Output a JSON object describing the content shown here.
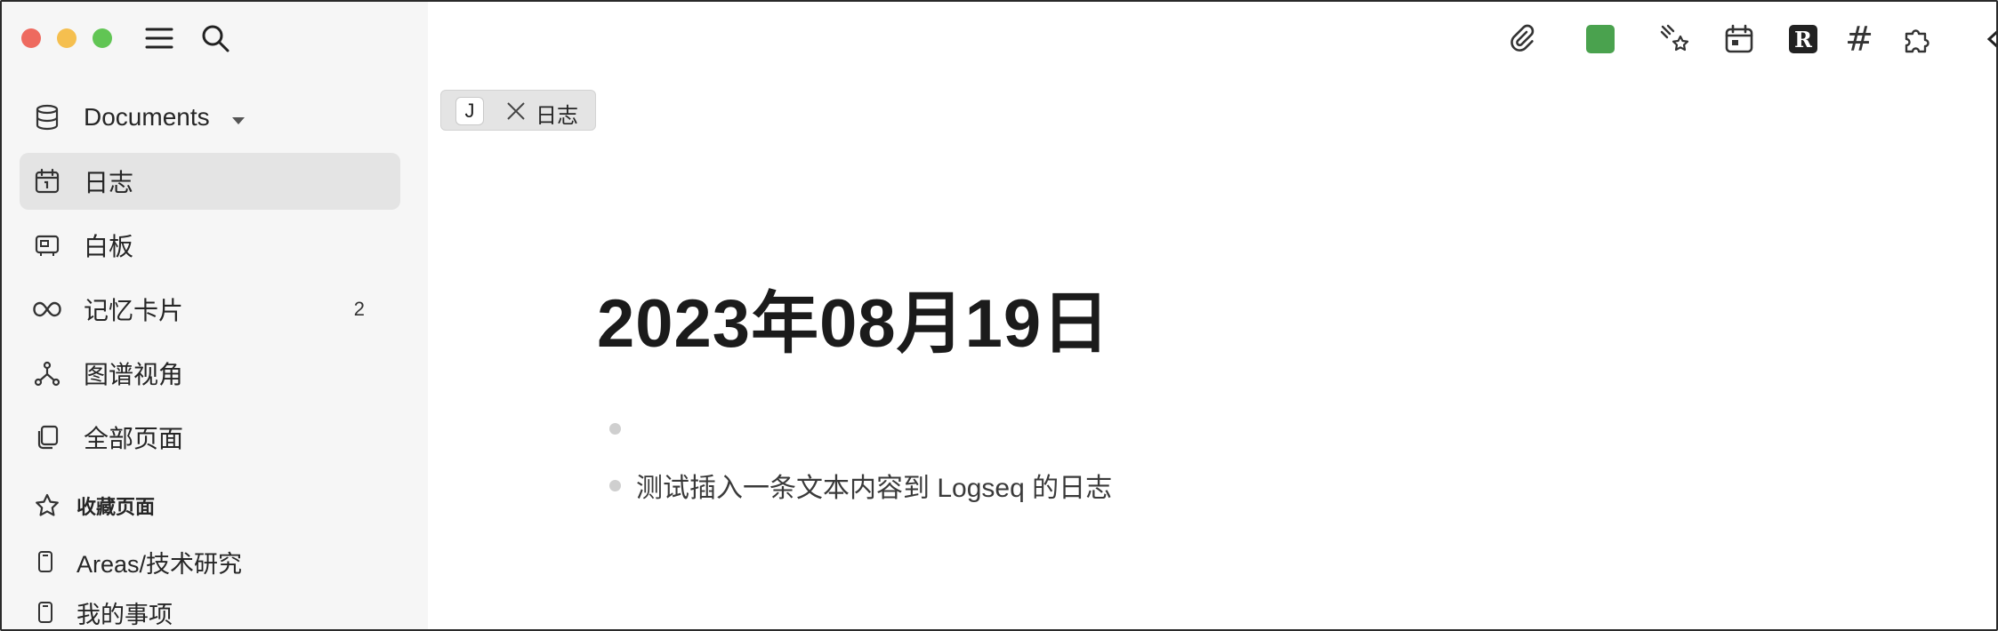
{
  "sidebar": {
    "graph_selector": {
      "label": "Documents",
      "icon": "database-icon"
    },
    "nav": [
      {
        "label": "日志",
        "icon": "calendar-icon",
        "active": true
      },
      {
        "label": "白板",
        "icon": "whiteboard-icon"
      },
      {
        "label": "记忆卡片",
        "icon": "infinity-icon",
        "count": "2"
      },
      {
        "label": "图谱视角",
        "icon": "graph-icon"
      },
      {
        "label": "全部页面",
        "icon": "pages-icon"
      }
    ],
    "favorites_header": "收藏页面",
    "favorites": [
      {
        "label": "Areas/技术研究"
      },
      {
        "label": "我的事项"
      }
    ]
  },
  "tab": {
    "badge": "J",
    "label": "日志"
  },
  "page": {
    "title": "2023年08月19日",
    "blocks": [
      {
        "text": ""
      },
      {
        "text": "测试插入一条文本内容到 Logseq 的日志"
      }
    ]
  },
  "toolbar": {
    "icons": [
      "paperclip-icon",
      "green-square",
      "sparkles-icon",
      "calendar-icon",
      "r-badge-icon",
      "hash-icon",
      "puzzle-icon",
      "arrow-left-icon"
    ],
    "r_badge": "R",
    "hash": "#",
    "accent_color": "#4aa24e"
  }
}
